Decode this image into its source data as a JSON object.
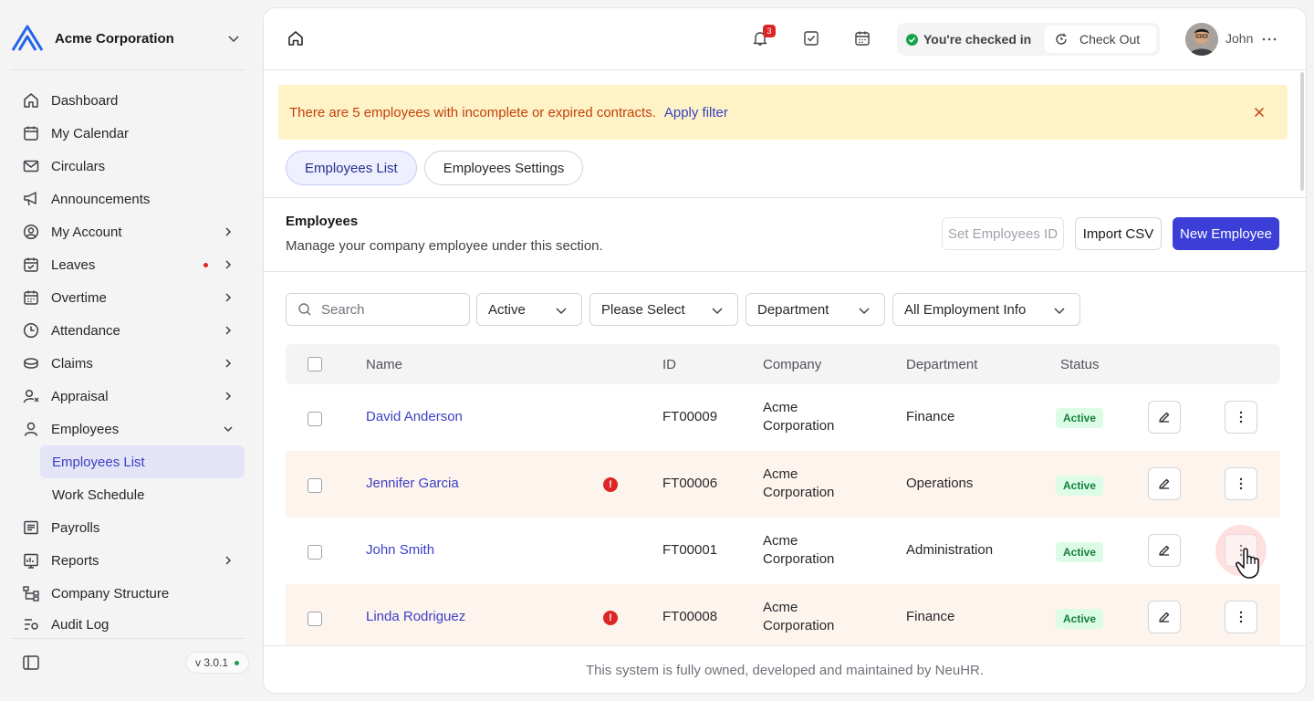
{
  "sidebar": {
    "company": "Acme Corporation",
    "version": "v 3.0.1",
    "items": [
      {
        "label": "Dashboard",
        "icon": "home-icon"
      },
      {
        "label": "My Calendar",
        "icon": "calendar-icon"
      },
      {
        "label": "Circulars",
        "icon": "mail-icon"
      },
      {
        "label": "Announcements",
        "icon": "megaphone-icon"
      },
      {
        "label": "My Account",
        "icon": "user-circle-icon"
      },
      {
        "label": "Leaves",
        "icon": "calendar-check-icon"
      },
      {
        "label": "Overtime",
        "icon": "calendar-clock-icon"
      },
      {
        "label": "Attendance",
        "icon": "clock-icon"
      },
      {
        "label": "Claims",
        "icon": "coins-icon"
      },
      {
        "label": "Appraisal",
        "icon": "user-star-icon"
      },
      {
        "label": "Employees",
        "icon": "user-icon"
      },
      {
        "label": "Payrolls",
        "icon": "receipt-icon"
      },
      {
        "label": "Reports",
        "icon": "report-icon"
      },
      {
        "label": "Company Structure",
        "icon": "hierarchy-icon"
      },
      {
        "label": "Audit Log",
        "icon": "audit-icon"
      }
    ],
    "employees_sub": [
      {
        "label": "Employees List"
      },
      {
        "label": "Work Schedule"
      }
    ]
  },
  "topbar": {
    "notification_count": "3",
    "checkin_text": "You're checked in",
    "checkout_label": "Check Out",
    "user_name": "John"
  },
  "alert": {
    "text": "There are 5 employees with incomplete or expired contracts.",
    "link": "Apply filter"
  },
  "tabs": [
    {
      "label": "Employees List"
    },
    {
      "label": "Employees Settings"
    }
  ],
  "section": {
    "title": "Employees",
    "subtitle": "Manage your company employee under this section.",
    "btn_set_id": "Set Employees ID",
    "btn_import": "Import CSV",
    "btn_new": "New Employee"
  },
  "filters": {
    "search_placeholder": "Search",
    "status": "Active",
    "select": "Please Select",
    "department": "Department",
    "employment": "All Employment Info"
  },
  "table": {
    "headers": {
      "name": "Name",
      "id": "ID",
      "company": "Company",
      "department": "Department",
      "status": "Status"
    },
    "rows": [
      {
        "name": "David Anderson",
        "id": "FT00009",
        "company_line1": "Acme",
        "company_line2": "Corporation",
        "department": "Finance",
        "status": "Active"
      },
      {
        "name": "Jennifer Garcia",
        "id": "FT00006",
        "company_line1": "Acme",
        "company_line2": "Corporation",
        "department": "Operations",
        "status": "Active"
      },
      {
        "name": "John Smith",
        "id": "FT00001",
        "company_line1": "Acme",
        "company_line2": "Corporation",
        "department": "Administration",
        "status": "Active"
      },
      {
        "name": "Linda Rodriguez",
        "id": "FT00008",
        "company_line1": "Acme",
        "company_line2": "Corporation",
        "department": "Finance",
        "status": "Active"
      }
    ]
  },
  "footer": "This system is fully owned, developed and maintained by NeuHR.",
  "colors": {
    "accent": "#3b3fd8",
    "warning_bg": "#fef3c7",
    "warning_text": "#c2410c",
    "success": "#16a34a",
    "danger": "#dc2626"
  }
}
